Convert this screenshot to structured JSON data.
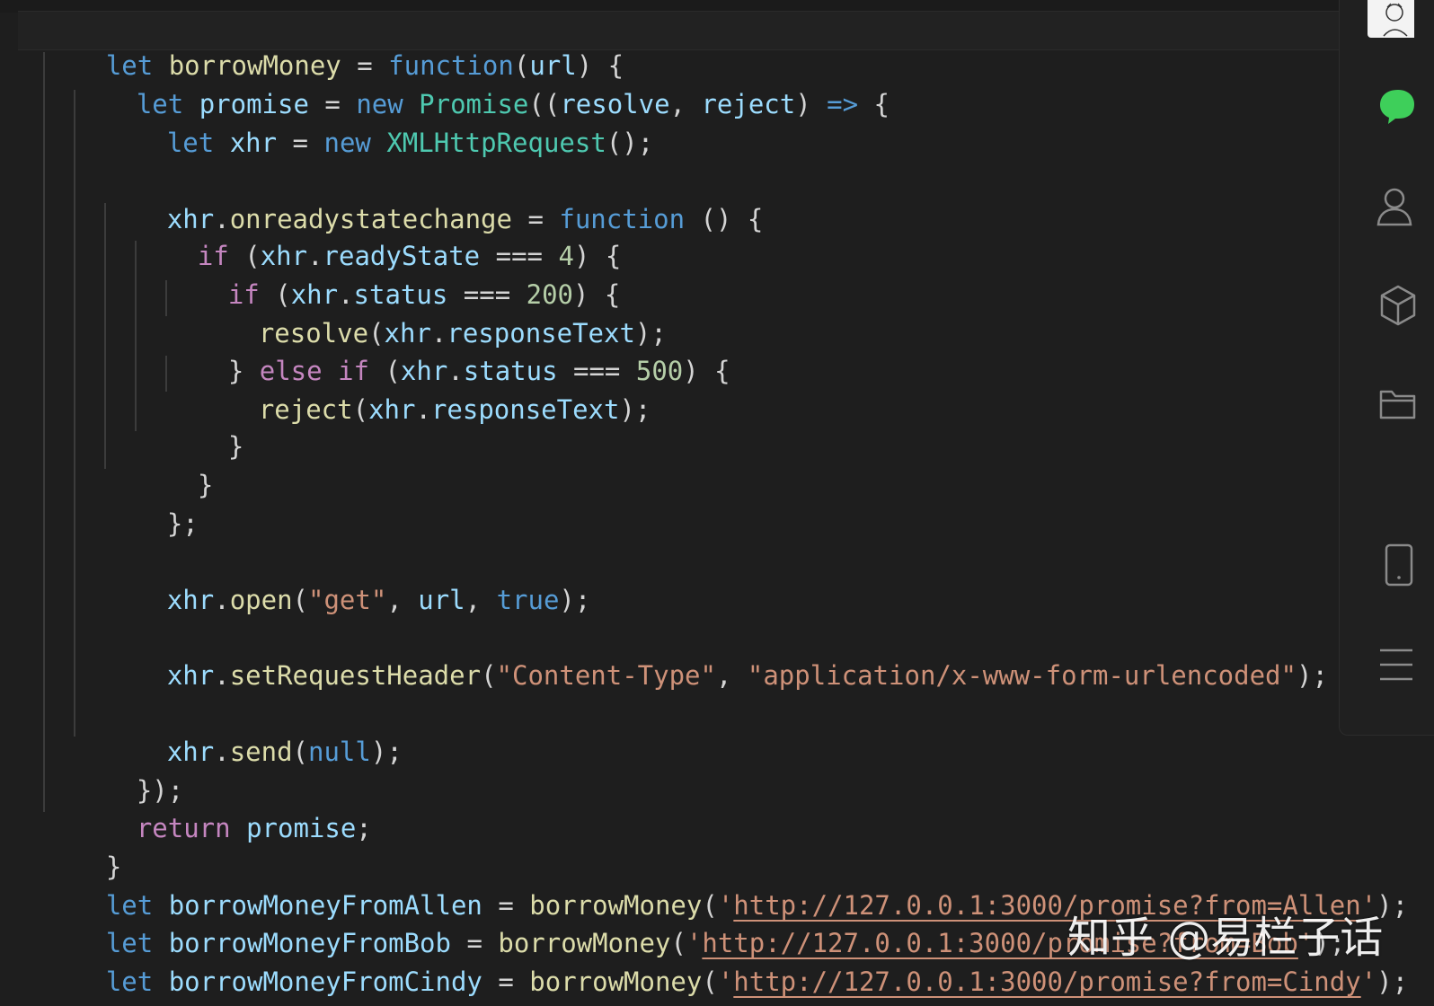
{
  "editor": {
    "lines": {
      "l1": {
        "let": "let",
        "name": "borrowMoney",
        "eq": " = ",
        "fn": "function",
        "open": "(",
        "param": "url",
        "close": ") {"
      },
      "l2": {
        "let": "let",
        "name": "promise",
        "eq": " = ",
        "new": "new",
        "type": "Promise",
        "open": "((",
        "a": "resolve",
        "comma": ", ",
        "b": "reject",
        "close": ") ",
        "arrow": "=>",
        "brace": " {"
      },
      "l3": {
        "let": "let",
        "name": "xhr",
        "eq": " = ",
        "new": "new",
        "type": "XMLHttpRequest",
        "tail": "();"
      },
      "l5": {
        "obj": "xhr",
        "dot": ".",
        "prop": "onreadystatechange",
        "eq": " = ",
        "fn": "function",
        "tail": " () {"
      },
      "l6": {
        "if": "if",
        "open": " (",
        "obj": "xhr",
        "dot": ".",
        "prop": "readyState",
        "op": " === ",
        "num": "4",
        "close": ") {"
      },
      "l7": {
        "if": "if",
        "open": " (",
        "obj": "xhr",
        "dot": ".",
        "prop": "status",
        "op": " === ",
        "num": "200",
        "close": ") {"
      },
      "l8": {
        "fn": "resolve",
        "open": "(",
        "obj": "xhr",
        "dot": ".",
        "prop": "responseText",
        "close": ");"
      },
      "l9": {
        "brace": "} ",
        "else": "else",
        "sp": " ",
        "if": "if",
        "open": " (",
        "obj": "xhr",
        "dot": ".",
        "prop": "status",
        "op": " === ",
        "num": "500",
        "close": ") {"
      },
      "l10": {
        "fn": "reject",
        "open": "(",
        "obj": "xhr",
        "dot": ".",
        "prop": "responseText",
        "close": ");"
      },
      "l11": {
        "text": "}"
      },
      "l12": {
        "text": "}"
      },
      "l13": {
        "text": "};"
      },
      "l15": {
        "obj": "xhr",
        "dot": ".",
        "fn": "open",
        "open": "(",
        "str": "\"get\"",
        "comma": ", ",
        "arg": "url",
        "comma2": ", ",
        "bool": "true",
        "close": ");"
      },
      "l17": {
        "obj": "xhr",
        "dot": ".",
        "fn": "setRequestHeader",
        "open": "(",
        "s1": "\"Content-Type\"",
        "comma": ", ",
        "s2": "\"application/x-www-form-urlencoded\"",
        "close": ");"
      },
      "l19": {
        "obj": "xhr",
        "dot": ".",
        "fn": "send",
        "open": "(",
        "nul": "null",
        "close": ");"
      },
      "l20": {
        "text": "});"
      },
      "l21": {
        "ret": "return",
        "sp": " ",
        "name": "promise",
        "semi": ";"
      },
      "l22": {
        "text": "}"
      },
      "l23": {
        "let": "let",
        "name": "borrowMoneyFromAllen",
        "eq": " = ",
        "fn": "borrowMoney",
        "open": "(",
        "q1": "'",
        "url": "http://127.0.0.1:3000/promise?from=Allen",
        "q2": "'",
        "close": ");"
      },
      "l24": {
        "let": "let",
        "name": "borrowMoneyFromBob",
        "eq": " = ",
        "fn": "borrowMoney",
        "open": "(",
        "q1": "'",
        "url": "http://127.0.0.1:3000/promise?from=Bob",
        "q2": "'",
        "close": ");"
      },
      "l25": {
        "let": "let",
        "name": "borrowMoneyFromCindy",
        "eq": " = ",
        "fn": "borrowMoney",
        "open": "(",
        "q1": "'",
        "url": "http://127.0.0.1:3000/promise?from=Cindy",
        "q2": "'",
        "close": ");"
      }
    }
  },
  "sidebar": {
    "icons": [
      "avatar",
      "chat-icon",
      "user-icon",
      "cube-icon",
      "folder-icon",
      "phone-icon",
      "menu-icon"
    ],
    "accent": "#3ecf5a"
  },
  "watermark": {
    "text": "知乎 @易栏子话"
  },
  "colors": {
    "background": "#1e1e1e",
    "keyword": "#569cd6",
    "control": "#c586c0",
    "function": "#dcdcaa",
    "variable": "#9cdcfe",
    "type": "#4ec9b0",
    "string": "#ce9178",
    "number": "#b5cea8"
  }
}
